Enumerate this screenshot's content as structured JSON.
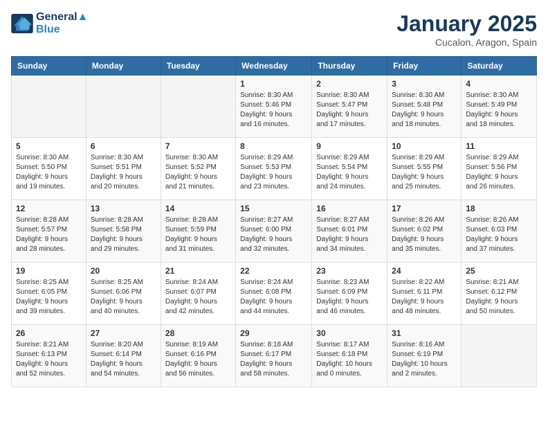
{
  "logo": {
    "line1": "General",
    "line2": "Blue"
  },
  "header": {
    "title": "January 2025",
    "location": "Cucalon, Aragon, Spain"
  },
  "days_of_week": [
    "Sunday",
    "Monday",
    "Tuesday",
    "Wednesday",
    "Thursday",
    "Friday",
    "Saturday"
  ],
  "weeks": [
    [
      {
        "day": "",
        "content": ""
      },
      {
        "day": "",
        "content": ""
      },
      {
        "day": "",
        "content": ""
      },
      {
        "day": "1",
        "content": "Sunrise: 8:30 AM\nSunset: 5:46 PM\nDaylight: 9 hours\nand 16 minutes."
      },
      {
        "day": "2",
        "content": "Sunrise: 8:30 AM\nSunset: 5:47 PM\nDaylight: 9 hours\nand 17 minutes."
      },
      {
        "day": "3",
        "content": "Sunrise: 8:30 AM\nSunset: 5:48 PM\nDaylight: 9 hours\nand 18 minutes."
      },
      {
        "day": "4",
        "content": "Sunrise: 8:30 AM\nSunset: 5:49 PM\nDaylight: 9 hours\nand 18 minutes."
      }
    ],
    [
      {
        "day": "5",
        "content": "Sunrise: 8:30 AM\nSunset: 5:50 PM\nDaylight: 9 hours\nand 19 minutes."
      },
      {
        "day": "6",
        "content": "Sunrise: 8:30 AM\nSunset: 5:51 PM\nDaylight: 9 hours\nand 20 minutes."
      },
      {
        "day": "7",
        "content": "Sunrise: 8:30 AM\nSunset: 5:52 PM\nDaylight: 9 hours\nand 21 minutes."
      },
      {
        "day": "8",
        "content": "Sunrise: 8:29 AM\nSunset: 5:53 PM\nDaylight: 9 hours\nand 23 minutes."
      },
      {
        "day": "9",
        "content": "Sunrise: 8:29 AM\nSunset: 5:54 PM\nDaylight: 9 hours\nand 24 minutes."
      },
      {
        "day": "10",
        "content": "Sunrise: 8:29 AM\nSunset: 5:55 PM\nDaylight: 9 hours\nand 25 minutes."
      },
      {
        "day": "11",
        "content": "Sunrise: 8:29 AM\nSunset: 5:56 PM\nDaylight: 9 hours\nand 26 minutes."
      }
    ],
    [
      {
        "day": "12",
        "content": "Sunrise: 8:28 AM\nSunset: 5:57 PM\nDaylight: 9 hours\nand 28 minutes."
      },
      {
        "day": "13",
        "content": "Sunrise: 8:28 AM\nSunset: 5:58 PM\nDaylight: 9 hours\nand 29 minutes."
      },
      {
        "day": "14",
        "content": "Sunrise: 8:28 AM\nSunset: 5:59 PM\nDaylight: 9 hours\nand 31 minutes."
      },
      {
        "day": "15",
        "content": "Sunrise: 8:27 AM\nSunset: 6:00 PM\nDaylight: 9 hours\nand 32 minutes."
      },
      {
        "day": "16",
        "content": "Sunrise: 8:27 AM\nSunset: 6:01 PM\nDaylight: 9 hours\nand 34 minutes."
      },
      {
        "day": "17",
        "content": "Sunrise: 8:26 AM\nSunset: 6:02 PM\nDaylight: 9 hours\nand 35 minutes."
      },
      {
        "day": "18",
        "content": "Sunrise: 8:26 AM\nSunset: 6:03 PM\nDaylight: 9 hours\nand 37 minutes."
      }
    ],
    [
      {
        "day": "19",
        "content": "Sunrise: 8:25 AM\nSunset: 6:05 PM\nDaylight: 9 hours\nand 39 minutes."
      },
      {
        "day": "20",
        "content": "Sunrise: 8:25 AM\nSunset: 6:06 PM\nDaylight: 9 hours\nand 40 minutes."
      },
      {
        "day": "21",
        "content": "Sunrise: 8:24 AM\nSunset: 6:07 PM\nDaylight: 9 hours\nand 42 minutes."
      },
      {
        "day": "22",
        "content": "Sunrise: 8:24 AM\nSunset: 6:08 PM\nDaylight: 9 hours\nand 44 minutes."
      },
      {
        "day": "23",
        "content": "Sunrise: 8:23 AM\nSunset: 6:09 PM\nDaylight: 9 hours\nand 46 minutes."
      },
      {
        "day": "24",
        "content": "Sunrise: 8:22 AM\nSunset: 6:11 PM\nDaylight: 9 hours\nand 48 minutes."
      },
      {
        "day": "25",
        "content": "Sunrise: 8:21 AM\nSunset: 6:12 PM\nDaylight: 9 hours\nand 50 minutes."
      }
    ],
    [
      {
        "day": "26",
        "content": "Sunrise: 8:21 AM\nSunset: 6:13 PM\nDaylight: 9 hours\nand 52 minutes."
      },
      {
        "day": "27",
        "content": "Sunrise: 8:20 AM\nSunset: 6:14 PM\nDaylight: 9 hours\nand 54 minutes."
      },
      {
        "day": "28",
        "content": "Sunrise: 8:19 AM\nSunset: 6:16 PM\nDaylight: 9 hours\nand 56 minutes."
      },
      {
        "day": "29",
        "content": "Sunrise: 8:18 AM\nSunset: 6:17 PM\nDaylight: 9 hours\nand 58 minutes."
      },
      {
        "day": "30",
        "content": "Sunrise: 8:17 AM\nSunset: 6:18 PM\nDaylight: 10 hours\nand 0 minutes."
      },
      {
        "day": "31",
        "content": "Sunrise: 8:16 AM\nSunset: 6:19 PM\nDaylight: 10 hours\nand 2 minutes."
      },
      {
        "day": "",
        "content": ""
      }
    ]
  ]
}
